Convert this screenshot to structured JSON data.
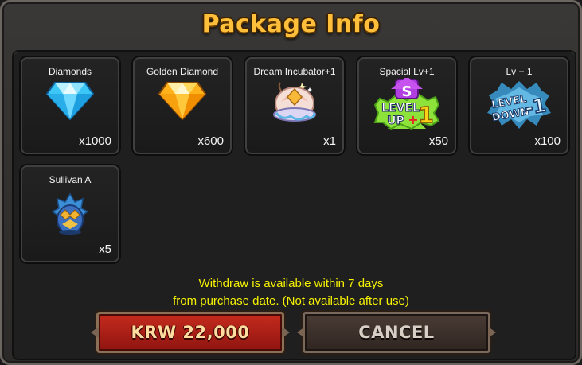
{
  "dialog": {
    "title": "Package Info",
    "items": [
      {
        "name": "Diamonds",
        "qty": "x1000",
        "icon": "blue-diamond-icon"
      },
      {
        "name": "Golden Diamond",
        "qty": "x600",
        "icon": "golden-diamond-icon"
      },
      {
        "name": "Dream Incubator+1",
        "qty": "x1",
        "icon": "dream-incubator-icon"
      },
      {
        "name": "Spacial Lv+1",
        "qty": "x50",
        "icon": "level-up-icon",
        "icon_text": [
          "S",
          "LEVEL",
          "UP",
          "+",
          "1"
        ]
      },
      {
        "name": "Lv − 1",
        "qty": "x100",
        "icon": "level-down-icon",
        "icon_text": [
          "LEVEL",
          "DOWN",
          "-1"
        ]
      },
      {
        "name": "Sullivan A",
        "qty": "x5",
        "icon": "sullivan-egg-icon"
      }
    ],
    "notice_line1": "Withdraw is available within 7 days",
    "notice_line2": "from purchase date. (Not available after use)",
    "buy_label": "KRW 22,000",
    "cancel_label": "CANCEL"
  },
  "colors": {
    "title": "#ffbf3a",
    "notice": "#f6f200",
    "buy_button": "#b8231a",
    "cancel_button": "#3d312b"
  }
}
